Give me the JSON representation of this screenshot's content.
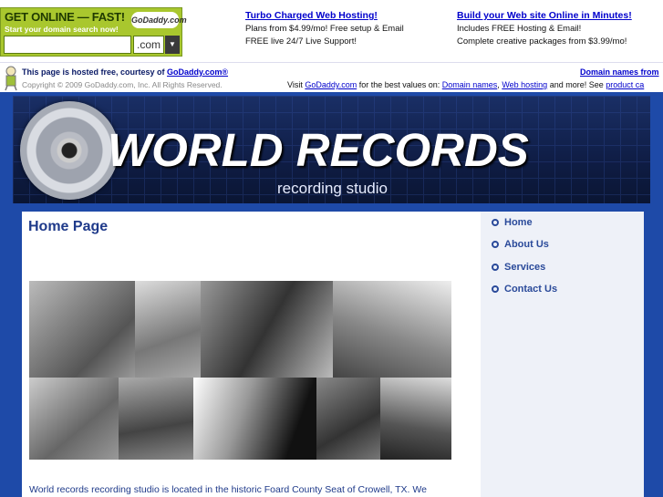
{
  "ad": {
    "godaddy": {
      "headline": "GET ONLINE — FAST!",
      "logo": "GoDaddy.com",
      "subtext": "Start your domain search now!",
      "input_value": "",
      "tld": ".com",
      "dropdown_glyph": "▼"
    },
    "col1": {
      "link": "Turbo Charged Web Hosting!",
      "line1": "Plans from $4.99/mo! Free setup & Email",
      "line2": "FREE live 24/7 Live Support!"
    },
    "col2": {
      "link": "Build your Web site Online in Minutes!",
      "line1": "Includes FREE Hosting & Email!",
      "line2": "Complete creative packages from $3.99/mo!"
    }
  },
  "hosted": {
    "prefix": "This page is hosted free, courtesy of ",
    "link": "GoDaddy.com®",
    "copyright": "Copyright © 2009 GoDaddy.com, Inc. All Rights Reserved.",
    "right_link": "Domain names from",
    "visit_prefix": "Visit ",
    "visit_link": "GoDaddy.com",
    "visit_mid": " for the best values on: ",
    "visit_link2": "Domain names",
    "visit_sep": ", ",
    "visit_link3": "Web hosting",
    "visit_and": " and more! See ",
    "visit_link4": "product ca"
  },
  "site": {
    "title": "WORLD RECORDS",
    "subtitle": "recording studio"
  },
  "main": {
    "page_title": "Home Page",
    "intro": "World records recording studio is located in the historic Foard County Seat of Crowell, TX.  We"
  },
  "nav": {
    "items": [
      {
        "label": "Home"
      },
      {
        "label": "About Us"
      },
      {
        "label": "Services"
      },
      {
        "label": "Contact Us"
      }
    ]
  },
  "colors": {
    "frame_blue": "#1e4aa8",
    "link_blue": "#0000cc",
    "nav_blue": "#2a4a9a",
    "godaddy_green": "#a9c72e"
  }
}
